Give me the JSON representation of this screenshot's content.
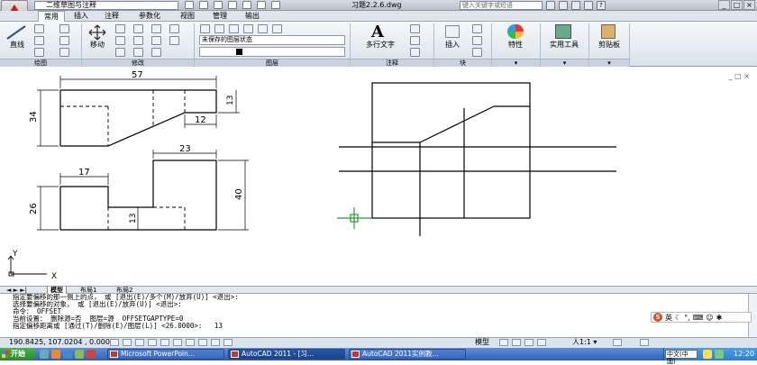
{
  "titlebar": {
    "workspace": "二维草图与注释",
    "document_title": "习题2.2.6.dwg",
    "search_placeholder": "键入关键字或短语",
    "window_controls": [
      "_",
      "□",
      "×"
    ]
  },
  "ribbon_tabs": [
    "常用",
    "插入",
    "注释",
    "参数化",
    "视图",
    "管理",
    "输出"
  ],
  "ribbon_panels": {
    "draw": {
      "label": "绘图",
      "big_button": "直线"
    },
    "modify": {
      "label": "修改",
      "big_button": "移动"
    },
    "layers": {
      "label": "图层",
      "state_combo": "未保存的图层状态",
      "layer_combo": "0"
    },
    "annotation": {
      "label": "注释",
      "big_button": "多行文字"
    },
    "block": {
      "label": "块",
      "big_button": "插入"
    },
    "properties": {
      "big_button": "特性"
    },
    "utilities": {
      "big_button": "实用工具"
    },
    "clipboard": {
      "big_button": "剪贴板"
    }
  },
  "drawing": {
    "dimensions": {
      "top_width": "57",
      "left_height": "34",
      "right_small_height": "13",
      "notch_width": "12",
      "lower_top_width": "23",
      "lower_left_width": "17",
      "lower_left_height": "26",
      "lower_right_height": "40",
      "lower_middle_height": "13"
    },
    "ucs_labels": {
      "y": "Y",
      "x": "X"
    },
    "viewport_controls": "_ □ ×"
  },
  "layout_tabs": [
    "模型",
    "布局1",
    "布局2"
  ],
  "command_lines": [
    "指定要偏移的那一侧上的点， 或 [退出(E)/多个(M)/放弃(U)] <退出>:",
    "选择要偏移的对象， 或 [退出(E)/放弃(U)] <退出>:",
    "命令： OFFSET",
    "当前设置： 删除源=否  图层=源  OFFSETGAPTYPE=0",
    "指定偏移距离或 [通过(T)/删除(E)/图层(L)] <26.0000>:   13"
  ],
  "ime": {
    "icon": "S",
    "lang": "英"
  },
  "statusbar": {
    "coords": "190.8425, 107.0204 , 0.0000",
    "model": "模型",
    "scale": "人1:1 ▾"
  },
  "taskbar": {
    "start": "开始",
    "tasks": [
      "Microsoft PowerPoin...",
      "AutoCAD 2011 - [习...",
      "AutoCAD 2011实例教..."
    ],
    "lang": "中文(中国)",
    "clock": "12:20"
  },
  "colors": {
    "autocad_red": "#c81e1e",
    "ribbon_bg": "#e6ebf1",
    "taskbar": "#3a68bd"
  }
}
